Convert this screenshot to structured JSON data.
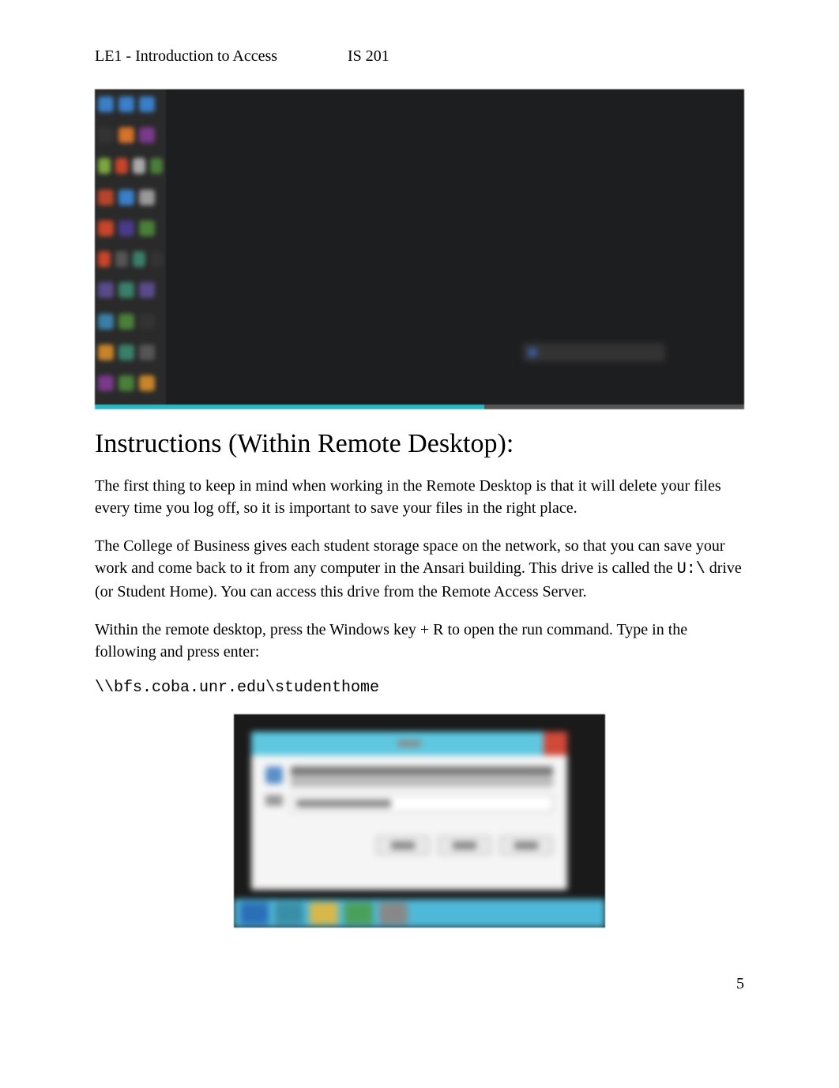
{
  "header": {
    "left": "LE1 - Introduction to Access",
    "right": "IS 201"
  },
  "heading": "Instructions (Within Remote Desktop):",
  "para1": "The first thing to keep in mind when working in the Remote Desktop is that it will delete your files every time you log off, so it is important to save your files in the right place.",
  "para2_a": "The College of Business gives each student storage space on the network, so that you can save your work and come back to it from any computer in the Ansari building. This drive is called the ",
  "para2_code": "U:\\",
  "para2_b": " drive (or Student Home). You can access this drive from the Remote Access Server.",
  "para3": "Within the remote desktop, press the Windows key + R to open the run command. Type in the following and press enter:",
  "command": "\\\\bfs.coba.unr.edu\\studenthome",
  "page_number": "5"
}
